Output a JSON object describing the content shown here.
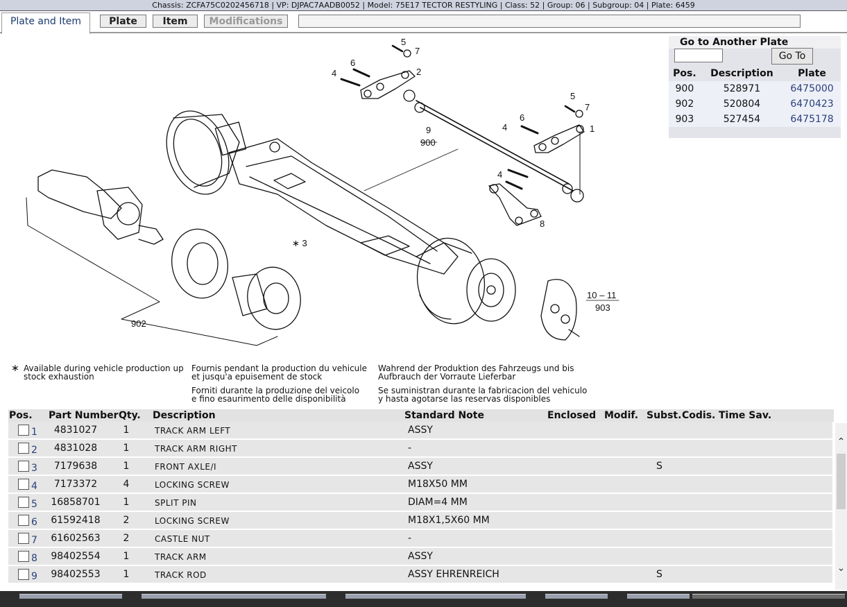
{
  "header": {
    "title": "Chassis: ZCFA75C0202456718 | VP: DJPAC7AADB0052 | Model: 75E17 TECTOR RESTYLING | Class: 52 | Group: 06 | Subgroup: 04 | Plate: 6459"
  },
  "tabs": {
    "active": "Plate and Item",
    "plate": "Plate",
    "item": "Item",
    "modifications": "Modifications"
  },
  "drawing": {
    "callouts": [
      "5",
      "7",
      "6",
      "2",
      "4",
      "9",
      "900",
      "5",
      "7",
      "6",
      "4",
      "1",
      "4",
      "8",
      "3",
      "902",
      "10 – 11",
      "903"
    ]
  },
  "goto": {
    "title": "Go to Another Plate",
    "button": "Go To",
    "input_value": "",
    "columns": [
      "Pos.",
      "Description",
      "Plate"
    ],
    "rows": [
      {
        "pos": "900",
        "description": "528971",
        "plate": "6475000"
      },
      {
        "pos": "902",
        "description": "520804",
        "plate": "6470423"
      },
      {
        "pos": "903",
        "description": "527454",
        "plate": "6475178"
      }
    ]
  },
  "legend": {
    "symbol": "∗",
    "en1": "Available during vehicle production up",
    "en2": "stock exhaustion",
    "fr1": "Fournis pendant la production du vehicule",
    "fr2": "et jusqu'a epuisement de stock",
    "it1": "Forniti durante la produzione del veicolo",
    "it2": "e fino esaurimento delle disponibilità",
    "de1": "Wahrend der Produktion des Fahrzeugs und bis",
    "de2": "Aufbrauch der Vorraute Lieferbar",
    "es1": "Se suministran durante la fabricacion del vehiculo",
    "es2": "y hasta agotarse las reservas disponibles"
  },
  "grid": {
    "columns": {
      "pos": "Pos.",
      "part_number": "Part Number",
      "qty": "Qty.",
      "description": "Description",
      "standard_note": "Standard Note",
      "enclosed": "Enclosed",
      "modif": "Modif.",
      "subst": "Subst.",
      "codis": "Codis.",
      "time_sav": "Time Sav."
    },
    "rows": [
      {
        "pos": "1",
        "part_number": "4831027",
        "qty": "1",
        "description": "TRACK ARM LEFT",
        "note": "ASSY",
        "subst": ""
      },
      {
        "pos": "2",
        "part_number": "4831028",
        "qty": "1",
        "description": "TRACK ARM RIGHT",
        "note": "-",
        "subst": ""
      },
      {
        "pos": "3",
        "part_number": "7179638",
        "qty": "1",
        "description": "FRONT AXLE/I",
        "note": "ASSY",
        "subst": "S"
      },
      {
        "pos": "4",
        "part_number": "7173372",
        "qty": "4",
        "description": "LOCKING SCREW",
        "note": "M18X50 MM",
        "subst": ""
      },
      {
        "pos": "5",
        "part_number": "16858701",
        "qty": "1",
        "description": "SPLIT PIN",
        "note": "DIAM=4 MM",
        "subst": ""
      },
      {
        "pos": "6",
        "part_number": "61592418",
        "qty": "2",
        "description": "LOCKING SCREW",
        "note": "M18X1,5X60 MM",
        "subst": ""
      },
      {
        "pos": "7",
        "part_number": "61602563",
        "qty": "2",
        "description": "CASTLE NUT",
        "note": "-",
        "subst": ""
      },
      {
        "pos": "8",
        "part_number": "98402554",
        "qty": "1",
        "description": "TRACK ARM",
        "note": "ASSY",
        "subst": ""
      },
      {
        "pos": "9",
        "part_number": "98402553",
        "qty": "1",
        "description": "TRACK ROD",
        "note": "ASSY EHRENREICH",
        "subst": "S"
      }
    ]
  },
  "scrollbar": {
    "up_icon": "chevron-up-icon",
    "down_icon": "chevron-down-icon"
  }
}
